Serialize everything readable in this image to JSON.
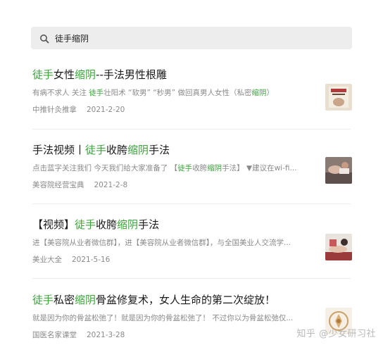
{
  "search": {
    "query": "徒手缩阴"
  },
  "results": [
    {
      "title": [
        {
          "text": "徒手",
          "hl": true
        },
        {
          "text": "女性",
          "hl": false
        },
        {
          "text": "缩阴",
          "hl": true
        },
        {
          "text": "--手法男性根雕",
          "hl": false
        }
      ],
      "snippet": [
        {
          "text": "有病不求人 关注 ",
          "hl": false
        },
        {
          "text": "徒手",
          "hl": true
        },
        {
          "text": "壮阳术 “软男” “秒男” 做回真男人女性（私密",
          "hl": false
        },
        {
          "text": "缩阴",
          "hl": true
        },
        {
          "text": "）",
          "hl": false
        }
      ],
      "source": "中推针灸推拿",
      "date": "2021-2-20",
      "thumb": "book-cover"
    },
    {
      "title": [
        {
          "text": "手法视频丨",
          "hl": false
        },
        {
          "text": "徒手",
          "hl": true
        },
        {
          "text": "收胯",
          "hl": false
        },
        {
          "text": "缩阴",
          "hl": true
        },
        {
          "text": "手法",
          "hl": false
        }
      ],
      "snippet": [
        {
          "text": "点击蓝字关注我们 今天我们给大家准备了 【",
          "hl": false
        },
        {
          "text": "徒手",
          "hl": true
        },
        {
          "text": "收胯",
          "hl": false
        },
        {
          "text": "缩阴",
          "hl": true
        },
        {
          "text": "手法】 ▼建议在wi-fi...",
          "hl": false
        }
      ],
      "source": "美容院经营宝典",
      "date": "2021-2-8",
      "thumb": "massage-photo"
    },
    {
      "title": [
        {
          "text": "【视频】",
          "hl": false
        },
        {
          "text": "徒手",
          "hl": true
        },
        {
          "text": "收胯",
          "hl": false
        },
        {
          "text": "缩阴",
          "hl": true
        },
        {
          "text": "手法",
          "hl": false
        }
      ],
      "snippet": [
        {
          "text": "进【美容院从业者微信群】，进【美容院从业者微信群】，与全国美业人交流学...",
          "hl": false
        }
      ],
      "source": "美业大全",
      "date": "2021-5-16",
      "thumb": "treatment-photo"
    },
    {
      "title": [
        {
          "text": "徒手",
          "hl": true
        },
        {
          "text": "私密",
          "hl": false
        },
        {
          "text": "缩阴",
          "hl": true
        },
        {
          "text": "骨盆修复术，女人生命的第二次绽放！",
          "hl": false
        }
      ],
      "snippet": [
        {
          "text": "就是因为你的骨盆松弛了！就是因为你的骨盆松弛了！ 不过你以为骨盆松弛仅...",
          "hl": false
        }
      ],
      "source": "国医名家课堂",
      "date": "2021-3-28",
      "thumb": "logo-badge"
    }
  ],
  "watermark": "知乎 @少女研习社",
  "colors": {
    "highlight": "#3aa33a",
    "meta": "#8a8a8a",
    "search_bg": "#ededed"
  }
}
